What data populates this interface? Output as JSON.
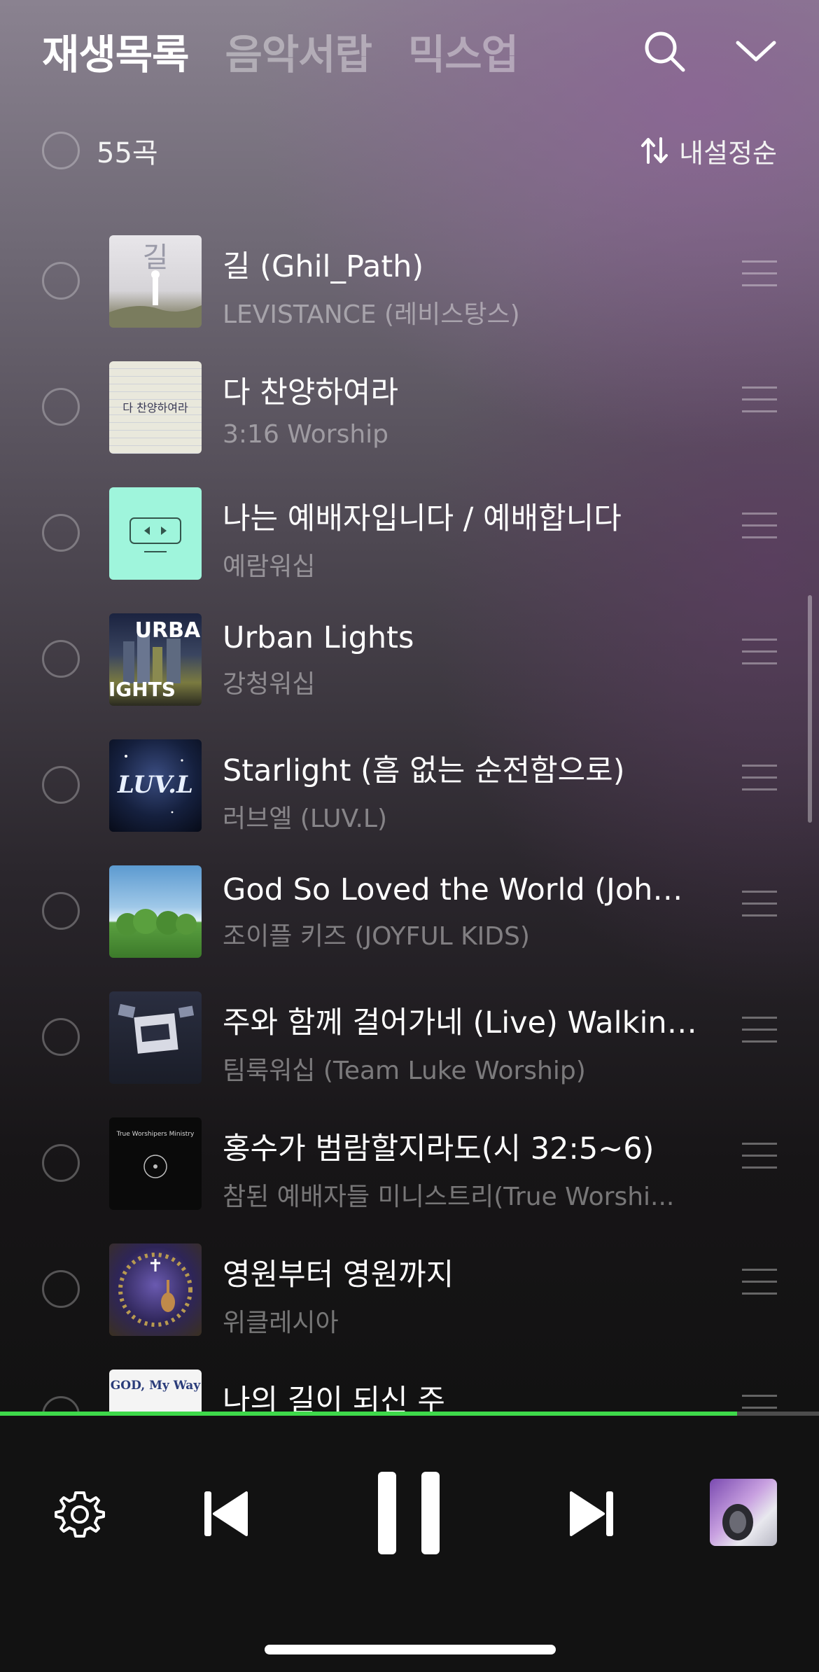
{
  "tabs": [
    {
      "label": "재생목록",
      "active": true
    },
    {
      "label": "음악서랍",
      "active": false
    },
    {
      "label": "믹스업",
      "active": false
    }
  ],
  "header_icons": [
    "search-icon",
    "chevron-down-icon"
  ],
  "list_header": {
    "count": "55곡",
    "sort_label": "내설정순"
  },
  "tracks": [
    {
      "title": "길 (Ghil_Path)",
      "artist": "LEVISTANCE (레비스탕스)"
    },
    {
      "title": "다 찬양하여라",
      "artist": "3:16 Worship"
    },
    {
      "title": "나는 예배자입니다 / 예배합니다",
      "artist": "예람워십"
    },
    {
      "title": "Urban Lights",
      "artist": "강청워십"
    },
    {
      "title": "Starlight (흠 없는 순전함으로)",
      "artist": "러브엘 (LUV.L)"
    },
    {
      "title": "God So Loved the World (John...",
      "artist": "조이플 키즈 (JOYFUL KIDS)"
    },
    {
      "title": "주와 함께 걸어가네 (Live) Walking...",
      "artist": "팀룩워십 (Team Luke Worship)"
    },
    {
      "title": "홍수가 범람할지라도(시 32:5~6)",
      "artist": "참된 예배자들 미니스트리(True Worshi..."
    },
    {
      "title": "영원부터 영원까지",
      "artist": "위클레시아"
    },
    {
      "title": "나의 길이 되신 주",
      "artist": ""
    }
  ],
  "album_art_text": {
    "t1": "길",
    "t2": "다 찬양하여라",
    "t4a": "URBAN",
    "t4b": "LIGHTS",
    "t5": "LUV.L",
    "t8": "True Worshipers Ministry",
    "t10": "GOD, My Way"
  },
  "playback": {
    "progress": 0.9,
    "accent": "#3ed94a",
    "state": "playing"
  },
  "controls": [
    "settings-icon",
    "previous-icon",
    "pause-icon",
    "next-icon",
    "now-playing-thumbnail"
  ]
}
